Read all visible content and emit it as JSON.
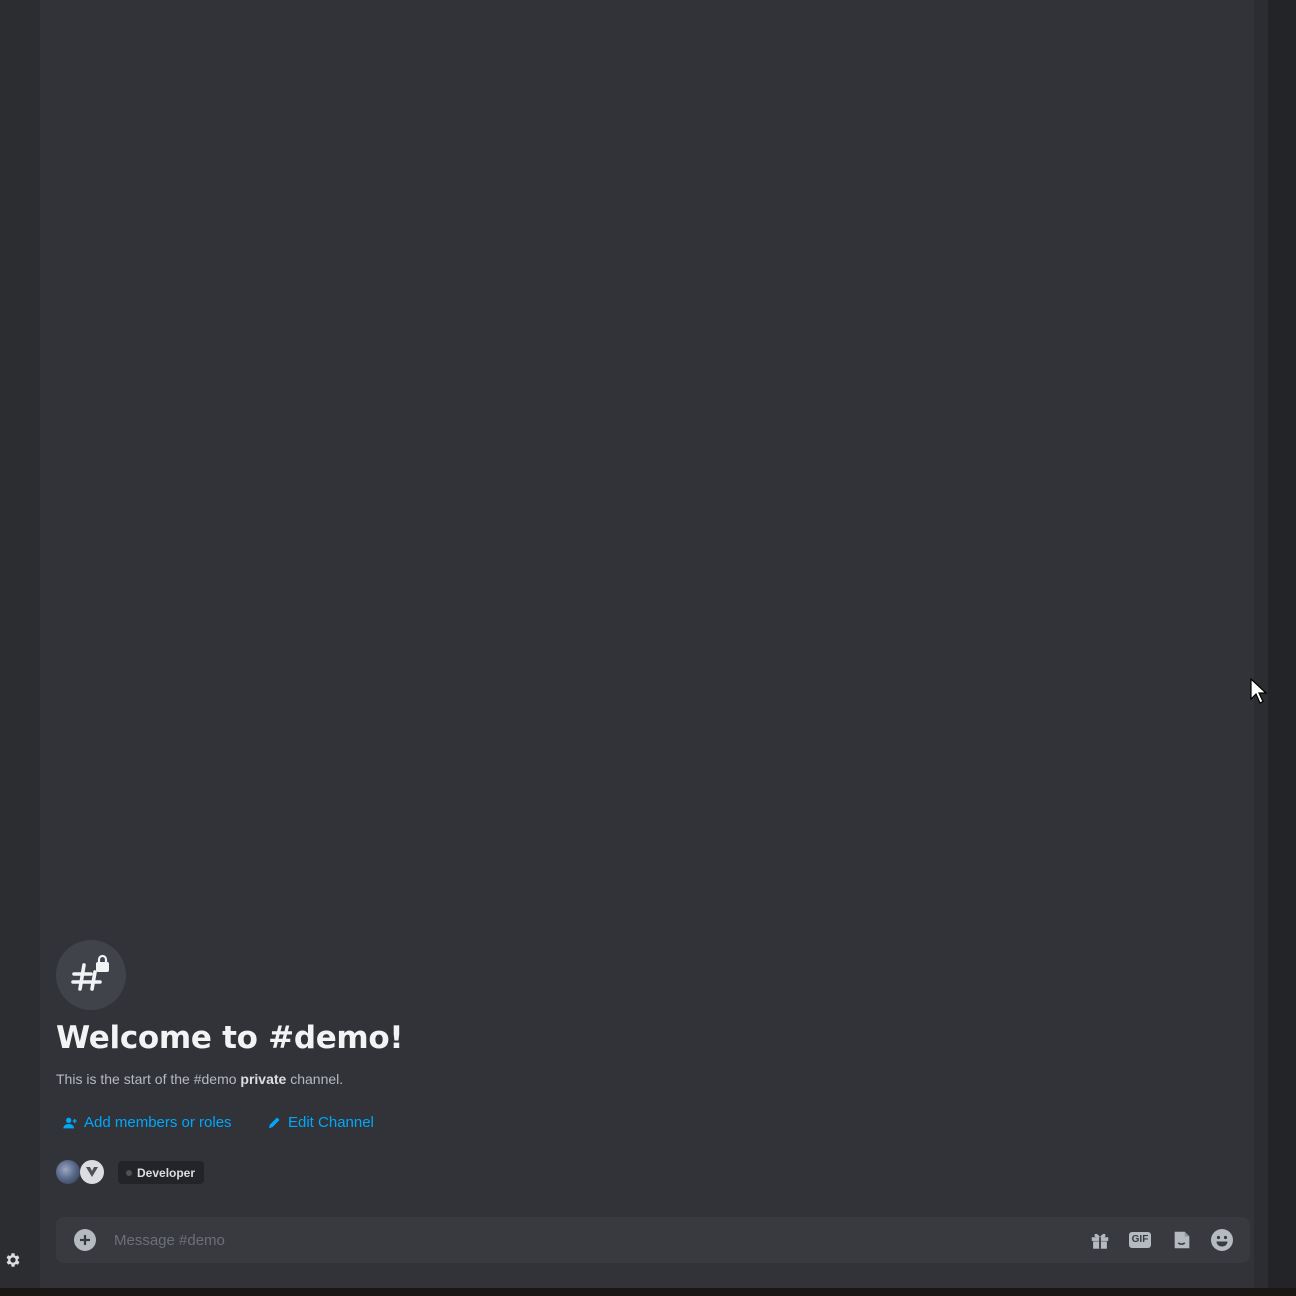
{
  "channel": {
    "name": "#demo",
    "welcome_title": "Welcome to #demo!",
    "subtitle_prefix": "This is the start of the #demo ",
    "subtitle_bold": "private",
    "subtitle_suffix": " channel.",
    "icon": "hashtag-lock-icon"
  },
  "actions": {
    "add_members_label": "Add members or roles",
    "add_members_icon": "add-person-icon",
    "edit_channel_label": "Edit Channel",
    "edit_channel_icon": "pencil-icon"
  },
  "members": {
    "avatars": [
      "avatar-user-1",
      "avatar-user-2"
    ],
    "role_label": "Developer"
  },
  "composer": {
    "placeholder": "Message #demo",
    "attach_icon": "plus-circle-icon",
    "buttons": [
      "gift-icon",
      "gif-icon",
      "sticker-icon",
      "emoji-icon"
    ],
    "gif_label": "GIF"
  },
  "sidebar": {
    "settings_icon": "gear-icon"
  },
  "colors": {
    "background": "#313338",
    "link": "#00a8fc",
    "title": "#f2f3f5",
    "composer": "#383a40"
  }
}
